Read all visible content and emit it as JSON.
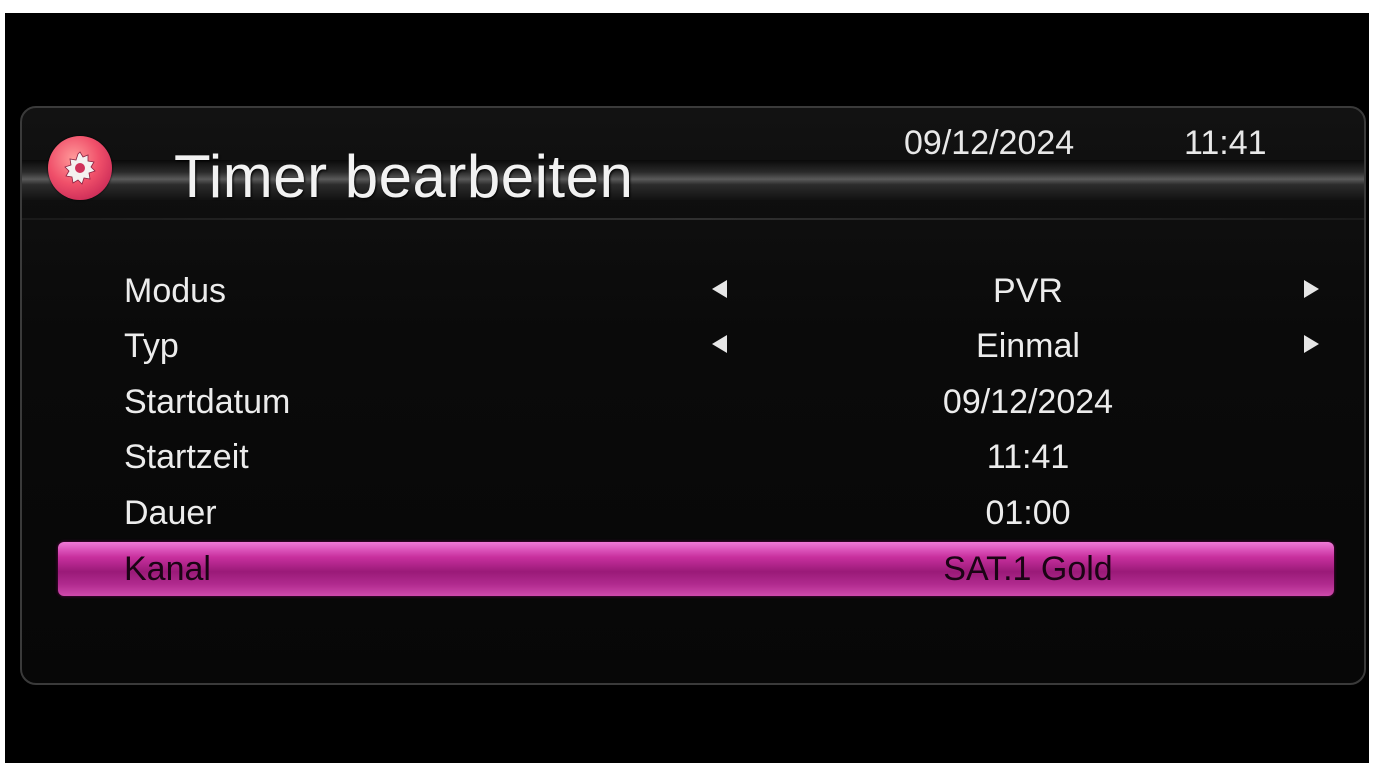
{
  "header": {
    "title": "Timer bearbeiten",
    "date": "09/12/2024",
    "time": "11:41",
    "logo_icon": "settings-gear-icon"
  },
  "rows": [
    {
      "label": "Modus",
      "value": "PVR",
      "has_arrows": true,
      "selected": false
    },
    {
      "label": "Typ",
      "value": "Einmal",
      "has_arrows": true,
      "selected": false
    },
    {
      "label": "Startdatum",
      "value": "09/12/2024",
      "has_arrows": false,
      "selected": false
    },
    {
      "label": "Startzeit",
      "value": "11:41",
      "has_arrows": false,
      "selected": false
    },
    {
      "label": "Dauer",
      "value": "01:00",
      "has_arrows": false,
      "selected": false
    },
    {
      "label": "Kanal",
      "value": "SAT.1 Gold",
      "has_arrows": false,
      "selected": true
    }
  ],
  "colors": {
    "background": "#000000",
    "panel": "#0a0a0a",
    "text": "#ececec",
    "highlight": "#c8309e",
    "logo": "#f0506a"
  }
}
